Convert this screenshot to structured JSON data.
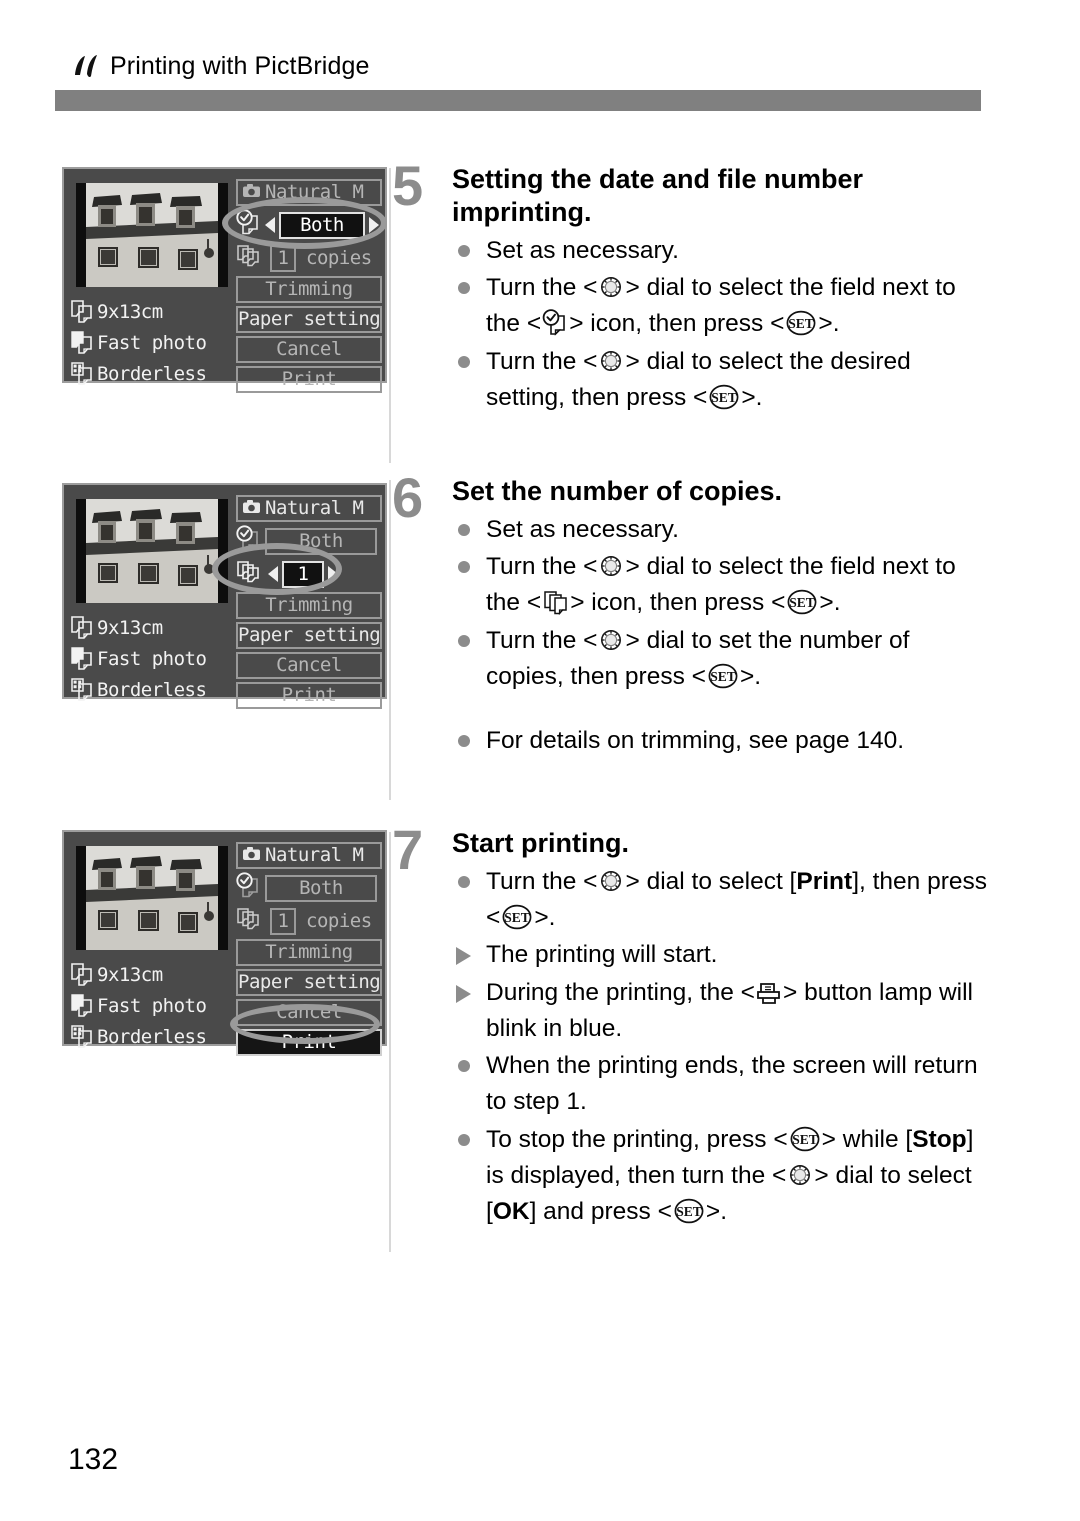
{
  "header": {
    "icon": "pictbridge-icon",
    "title": "Printing with PictBridge"
  },
  "page_number": "132",
  "lcd_screens": [
    {
      "id": "lcd-step5",
      "photo_alt": "black and white photo of stone building with dormer windows",
      "left_rows": [
        {
          "icon": "paper-size-icon",
          "label": "9x13cm"
        },
        {
          "icon": "paper-type-icon",
          "label": "Fast photo"
        },
        {
          "icon": "page-layout-icon",
          "label": "Borderless"
        }
      ],
      "rows": [
        {
          "icon": "camera-icon",
          "label": "Natural M",
          "state": "dim"
        },
        {
          "icon": "date-imprint-icon",
          "value": "Both",
          "state": "selected",
          "arrows": true
        },
        {
          "icon": "copies-icon",
          "value": "1",
          "suffix": "copies",
          "state": "dim"
        }
      ],
      "buttons": [
        {
          "label": "Trimming",
          "state": "dim"
        },
        {
          "label": "Paper settings",
          "state": "bright"
        },
        {
          "label": "Cancel",
          "state": "dim"
        },
        {
          "label": "Print",
          "state": "dim"
        }
      ],
      "highlight": "date-imprint-row"
    },
    {
      "id": "lcd-step6",
      "photo_alt": "black and white photo of stone building with dormer windows",
      "left_rows": [
        {
          "icon": "paper-size-icon",
          "label": "9x13cm"
        },
        {
          "icon": "paper-type-icon",
          "label": "Fast photo"
        },
        {
          "icon": "page-layout-icon",
          "label": "Borderless"
        }
      ],
      "rows": [
        {
          "icon": "camera-icon",
          "label": "Natural M",
          "state": "bright"
        },
        {
          "icon": "date-imprint-icon",
          "value": "Both",
          "state": "dim"
        },
        {
          "icon": "copies-icon",
          "value": "1",
          "state": "selected",
          "arrows": true
        }
      ],
      "buttons": [
        {
          "label": "Trimming",
          "state": "dim"
        },
        {
          "label": "Paper settings",
          "state": "bright"
        },
        {
          "label": "Cancel",
          "state": "dim"
        },
        {
          "label": "Print",
          "state": "dim"
        }
      ],
      "highlight": "copies-row"
    },
    {
      "id": "lcd-step7",
      "photo_alt": "black and white photo of stone building with dormer windows",
      "left_rows": [
        {
          "icon": "paper-size-icon",
          "label": "9x13cm"
        },
        {
          "icon": "paper-type-icon",
          "label": "Fast photo"
        },
        {
          "icon": "page-layout-icon",
          "label": "Borderless"
        }
      ],
      "rows": [
        {
          "icon": "camera-icon",
          "label": "Natural M",
          "state": "bright"
        },
        {
          "icon": "date-imprint-icon",
          "value": "Both",
          "state": "dim"
        },
        {
          "icon": "copies-icon",
          "value": "1",
          "suffix": "copies",
          "state": "dim"
        }
      ],
      "buttons": [
        {
          "label": "Trimming",
          "state": "dim"
        },
        {
          "label": "Paper settings",
          "state": "bright"
        },
        {
          "label": "Cancel",
          "state": "dim"
        },
        {
          "label": "Print",
          "state": "selected"
        }
      ],
      "highlight": "print-button"
    }
  ],
  "steps": [
    {
      "number": "5",
      "title": "Setting the date and file number imprinting.",
      "bullets": [
        {
          "marker": "dot",
          "text": "Set as necessary."
        },
        {
          "marker": "dot",
          "text": "Turn the < ○ > dial to select the field next to the < ○ > icon, then press < SET >."
        },
        {
          "marker": "dot",
          "text": "Turn the < ○ > dial to select the desired setting, then press < SET >."
        }
      ]
    },
    {
      "number": "6",
      "title": "Set the number of copies.",
      "bullets": [
        {
          "marker": "dot",
          "text": "Set as necessary."
        },
        {
          "marker": "dot",
          "text": "Turn the < ○ > dial to select the field next to the < ○ > icon, then press < SET >."
        },
        {
          "marker": "dot",
          "text": "Turn the < ○ > dial to set the number of copies, then press < SET >."
        },
        {
          "marker": "dot",
          "text": "For details on trimming, see page 140."
        }
      ]
    },
    {
      "number": "7",
      "title": "Start printing.",
      "bullets": [
        {
          "marker": "dot",
          "text": "Turn the < ○ > dial to select [Print], then press < SET >."
        },
        {
          "marker": "tri",
          "text": "The printing will start."
        },
        {
          "marker": "tri",
          "text": "During the printing, the < print > button lamp will blink in blue."
        },
        {
          "marker": "dot",
          "text": "When the printing ends, the screen will return to step 1."
        },
        {
          "marker": "dot",
          "text": "To stop the printing, press < SET > while [Stop] is displayed, then turn the < ○ > dial to select [OK] and press < SET >."
        }
      ]
    }
  ],
  "step5_text": {
    "b1": "Set as necessary.",
    "b2_a": "Turn the <",
    "b2_b": "> dial to select the field next to the <",
    "b2_c": "> icon, then press <",
    "b2_d": ">.",
    "b3_a": "Turn the <",
    "b3_b": "> dial to select the desired setting, then press <",
    "b3_c": ">."
  },
  "step6_text": {
    "b1": "Set as necessary.",
    "b2_a": "Turn the <",
    "b2_b": "> dial to select the field next to the <",
    "b2_c": "> icon, then press <",
    "b2_d": ">.",
    "b3_a": "Turn the <",
    "b3_b": "> dial to set the number of copies, then press <",
    "b3_c": ">.",
    "b4": "For details on trimming, see page 140."
  },
  "step7_text": {
    "b1_a": "Turn the <",
    "b1_b": "> dial to select [",
    "b1_print": "Print",
    "b1_c": "], then press <",
    "b1_d": ">.",
    "b2": "The printing will start.",
    "b3_a": "During the printing, the <",
    "b3_b": "> button lamp will blink in blue.",
    "b4": "When the printing ends, the screen will return to step 1.",
    "b5_a": "To stop the printing, press <",
    "b5_b": "> while [",
    "b5_stop": "Stop",
    "b5_c": "] is displayed, then turn the <",
    "b5_d": "> dial to select [",
    "b5_ok": "OK",
    "b5_e": "] and press <",
    "b5_f": ">."
  },
  "colors": {
    "header_bar": "#808080",
    "step_number": "#8c8c8c",
    "bullet": "#8c8c8c",
    "lcd_background": "#4a4a4a",
    "lcd_border": "#9d9d9d",
    "lcd_text_dim": "#b5b5b5",
    "lcd_text_bright": "#e8e8e8",
    "highlight_ring": "#9a9a9a"
  }
}
